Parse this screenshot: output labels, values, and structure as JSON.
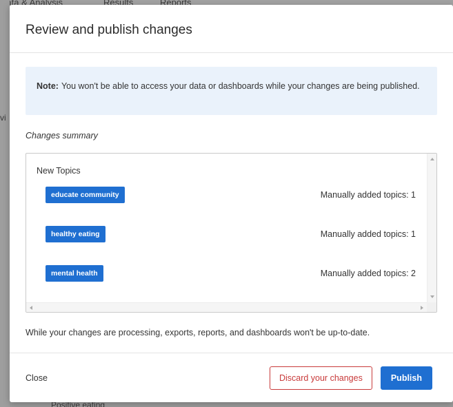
{
  "background": {
    "tabs": [
      "Data & Analysis",
      "Results",
      "Reports"
    ],
    "left_fragment": "vi",
    "bottom_fragment": "Positive eating"
  },
  "modal": {
    "title": "Review and publish changes",
    "note": {
      "label": "Note:",
      "text": "You won't be able to access your data or dashboards while your changes are being published."
    },
    "summary_label": "Changes summary",
    "group_title": "New Topics",
    "topics": [
      {
        "name": "educate community",
        "count_text": "Manually added topics: 1"
      },
      {
        "name": "healthy eating",
        "count_text": "Manually added topics: 1"
      },
      {
        "name": "mental health",
        "count_text": "Manually added topics: 2"
      }
    ],
    "processing_note": "While your changes are processing, exports, reports, and dashboards won't be up-to-date.",
    "footer": {
      "close_label": "Close",
      "discard_label": "Discard your changes",
      "publish_label": "Publish"
    }
  },
  "colors": {
    "accent": "#1f6fd1",
    "danger": "#c83a3a",
    "note_bg": "#eaf2fb"
  }
}
